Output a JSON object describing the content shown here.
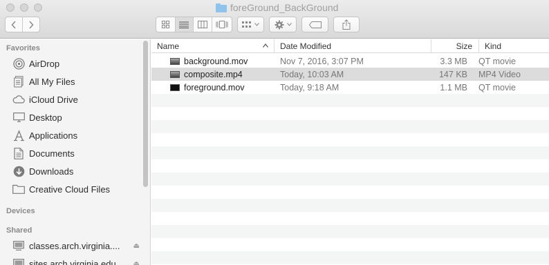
{
  "window": {
    "title": "foreGround_BackGround"
  },
  "toolbar": {
    "back_icon": "chevron-left-icon",
    "forward_icon": "chevron-right-icon",
    "views": [
      "icon-view-icon",
      "list-view-icon",
      "column-view-icon",
      "cover-flow-icon"
    ],
    "active_view": "list-view-icon",
    "arrange_icon": "arrange-grid-icon",
    "action_icon": "gear-icon",
    "tags_icon": "tag-icon",
    "share_icon": "share-icon"
  },
  "sidebar": {
    "favorites_title": "Favorites",
    "favorites": [
      {
        "label": "AirDrop",
        "icon": "airdrop-icon"
      },
      {
        "label": "All My Files",
        "icon": "all-files-icon"
      },
      {
        "label": "iCloud Drive",
        "icon": "cloud-icon"
      },
      {
        "label": "Desktop",
        "icon": "desktop-icon"
      },
      {
        "label": "Applications",
        "icon": "applications-icon"
      },
      {
        "label": "Documents",
        "icon": "documents-icon"
      },
      {
        "label": "Downloads",
        "icon": "downloads-icon"
      },
      {
        "label": "Creative Cloud Files",
        "icon": "folder-icon"
      }
    ],
    "devices_title": "Devices",
    "shared_title": "Shared",
    "shared": [
      {
        "label": "classes.arch.virginia....",
        "icon": "server-icon"
      },
      {
        "label": "sites.arch.virginia.edu",
        "icon": "server-icon"
      }
    ]
  },
  "columns": {
    "name": "Name",
    "date": "Date Modified",
    "size": "Size",
    "kind": "Kind"
  },
  "files": [
    {
      "name": "background.mov",
      "date": "Nov 7, 2016, 3:07 PM",
      "size": "3.3 MB",
      "kind": "QT movie"
    },
    {
      "name": "composite.mp4",
      "date": "Today, 10:03 AM",
      "size": "147 KB",
      "kind": "MP4 Video"
    },
    {
      "name": "foreground.mov",
      "date": "Today, 9:18 AM",
      "size": "1.1 MB",
      "kind": "QT movie"
    }
  ]
}
